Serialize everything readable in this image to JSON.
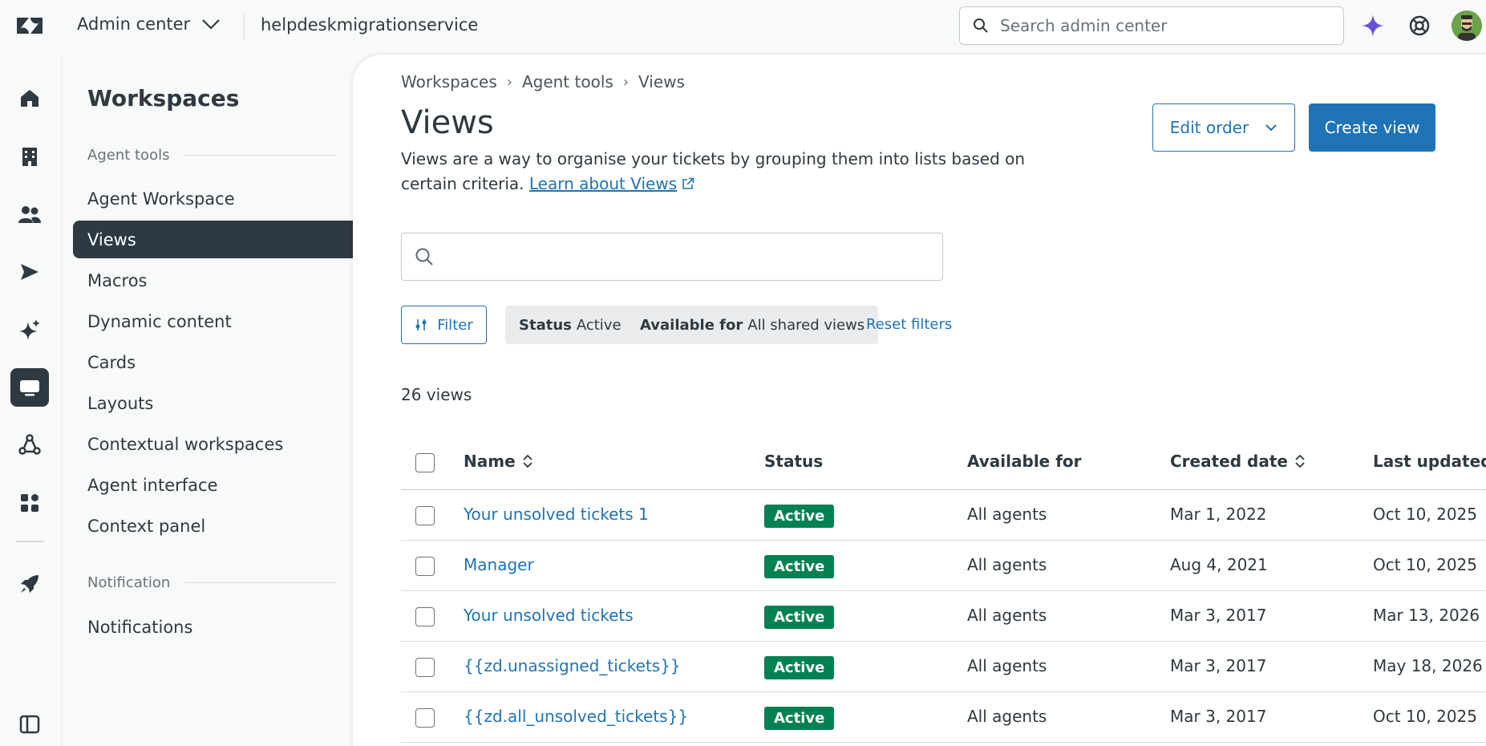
{
  "topbar": {
    "product": "Admin center",
    "account": "helpdeskmigrationservice",
    "search_placeholder": "Search admin center",
    "icons": [
      "zendesk-logo-icon",
      "chevron-down-icon",
      "search-icon",
      "ai-sparkle-icon",
      "help-lifebuoy-icon",
      "user-avatar"
    ]
  },
  "rail": {
    "items": [
      "home-icon",
      "building-icon",
      "people-icon",
      "send-icon",
      "ai-sparkle-icon",
      "workspace-monitor-icon",
      "objects-icon",
      "apps-icon",
      "rocket-icon",
      "sidebar-toggle-icon"
    ],
    "active": "workspace-monitor-icon"
  },
  "subnav": {
    "title": "Workspaces",
    "group1": "Agent tools",
    "items1": [
      "Agent Workspace",
      "Views",
      "Macros",
      "Dynamic content",
      "Cards",
      "Layouts",
      "Contextual workspaces",
      "Agent interface",
      "Context panel"
    ],
    "group2": "Notification",
    "items2": [
      "Notifications"
    ],
    "active": "Views"
  },
  "main": {
    "breadcrumb": [
      "Workspaces",
      "Agent tools",
      "Views"
    ],
    "title": "Views",
    "description": "Views are a way to organise your tickets by grouping them into lists based on certain criteria.",
    "learn_link": "Learn about Views",
    "edit_order": "Edit order",
    "create_view": "Create view",
    "filter": "Filter",
    "chip_status_label": "Status",
    "chip_status_value": "Active",
    "chip_available_label": "Available for",
    "chip_available_value": "All shared views",
    "reset_filters": "Reset filters",
    "count": "26 views"
  },
  "table": {
    "columns": [
      "Name",
      "Status",
      "Available for",
      "Created date",
      "Last updated"
    ],
    "rows": [
      {
        "name": "Your unsolved tickets 1",
        "status": "Active",
        "available": "All agents",
        "created": "Mar 1, 2022",
        "updated": "Oct 10, 2025"
      },
      {
        "name": "Manager",
        "status": "Active",
        "available": "All agents",
        "created": "Aug 4, 2021",
        "updated": "Oct 10, 2025"
      },
      {
        "name": "Your unsolved tickets",
        "status": "Active",
        "available": "All agents",
        "created": "Mar 3, 2017",
        "updated": "Mar 13, 2026"
      },
      {
        "name": "{{zd.unassigned_tickets}}",
        "status": "Active",
        "available": "All agents",
        "created": "Mar 3, 2017",
        "updated": "May 18, 2026"
      },
      {
        "name": "{{zd.all_unsolved_tickets}}",
        "status": "Active",
        "available": "All agents",
        "created": "Mar 3, 2017",
        "updated": "Oct 10, 2025"
      }
    ]
  },
  "colors": {
    "accent": "#1f73b7",
    "active_badge": "#038153",
    "nav_active": "#2f3941",
    "ai_purple": "#6a4fd8"
  }
}
